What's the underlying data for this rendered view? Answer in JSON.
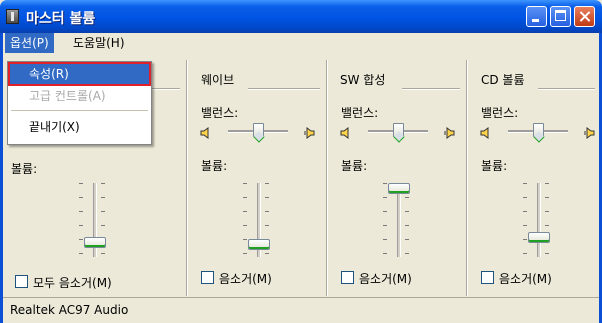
{
  "window": {
    "title": "마스터 볼륨"
  },
  "menubar": {
    "items": [
      "옵션(P)",
      "도움말(H)"
    ]
  },
  "dropdown": {
    "items": [
      "속성(R)",
      "고급 컨트롤(A)",
      "끝내기(X)"
    ]
  },
  "columns": [
    {
      "title": "",
      "balance_label": "",
      "volume_label": "볼륨:",
      "volume_level": 0.25,
      "balance": 0.5,
      "checkbox": "모두 음소거(M)"
    },
    {
      "title": "웨이브",
      "balance_label": "밸런스:",
      "volume_label": "볼륨:",
      "volume_level": 0.2,
      "balance": 0.5,
      "checkbox": "음소거(M)"
    },
    {
      "title": "SW 합성",
      "balance_label": "밸런스:",
      "volume_label": "볼륨:",
      "volume_level": 0.98,
      "balance": 0.5,
      "checkbox": "음소거(M)"
    },
    {
      "title": "CD 볼륨",
      "balance_label": "밸런스:",
      "volume_label": "볼륨:",
      "volume_level": 0.3,
      "balance": 0.5,
      "checkbox": "음소거(M)"
    }
  ],
  "status": {
    "text": "Realtek AC97 Audio"
  },
  "icons": {
    "app": "mixer-icon",
    "speaker_left": "speaker-low-icon",
    "speaker_right": "speaker-high-icon"
  }
}
